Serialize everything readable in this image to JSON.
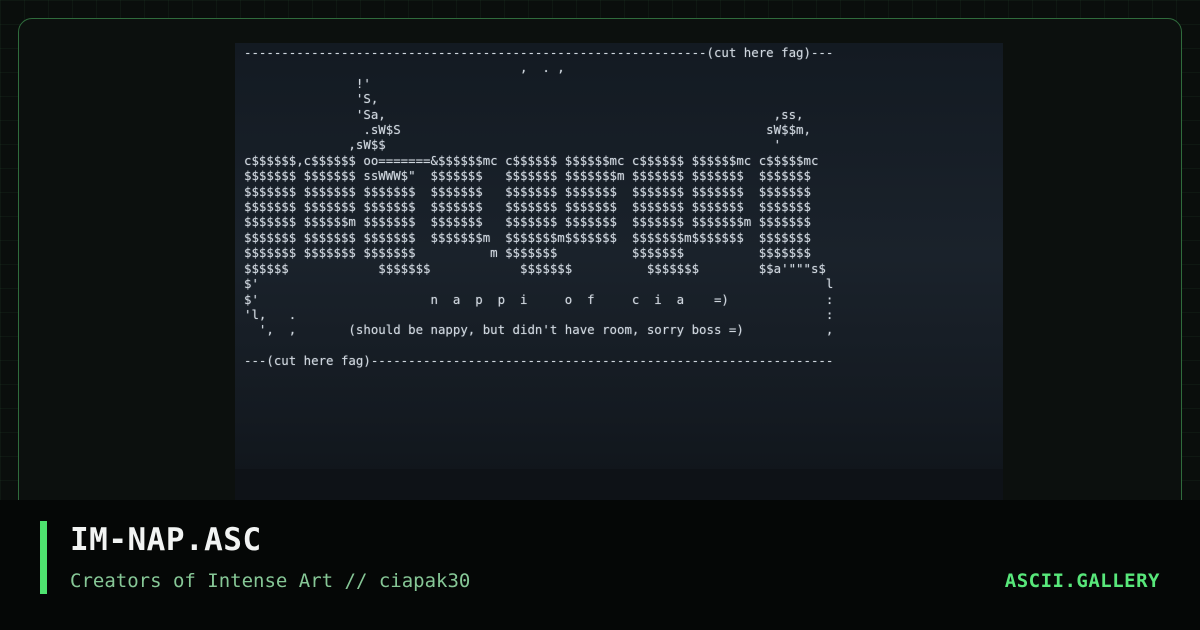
{
  "artwork": {
    "ascii_lines": [
      "--------------------------------------------------------------(cut here fag)---",
      "                                     ,  . ,",
      "               !'",
      "               'S,",
      "               'Sa,                                                    ,ss,",
      "                .sW$S                                                 sW$$m,",
      "              ,sW$$                                                    '",
      "c$$$$$$,c$$$$$$ oo=======&$$$$$$mc c$$$$$$ $$$$$$mc c$$$$$$ $$$$$$mc c$$$$$mc",
      "$$$$$$$ $$$$$$$ ssWWW$\"  $$$$$$$   $$$$$$$ $$$$$$$m $$$$$$$ $$$$$$$  $$$$$$$",
      "$$$$$$$ $$$$$$$ $$$$$$$  $$$$$$$   $$$$$$$ $$$$$$$  $$$$$$$ $$$$$$$  $$$$$$$",
      "$$$$$$$ $$$$$$$ $$$$$$$  $$$$$$$   $$$$$$$ $$$$$$$  $$$$$$$ $$$$$$$  $$$$$$$",
      "$$$$$$$ $$$$$$m $$$$$$$  $$$$$$$   $$$$$$$ $$$$$$$  $$$$$$$ $$$$$$$m $$$$$$$",
      "$$$$$$$ $$$$$$$ $$$$$$$  $$$$$$$m  $$$$$$$m$$$$$$$  $$$$$$$m$$$$$$$  $$$$$$$",
      "$$$$$$$ $$$$$$$ $$$$$$$          m $$$$$$$          $$$$$$$          $$$$$$$",
      "$$$$$$            $$$$$$$            $$$$$$$          $$$$$$$        $$a'\"\"\"s$",
      "$'                                                                            l",
      "$'                       n  a  p  p  i     o  f     c  i  a    =)             :",
      "'l,   .                                                                       :",
      "  ',  ,       (should be nappy, but didn't have room, sorry boss =)           ,",
      "",
      "---(cut here fag)--------------------------------------------------------------"
    ]
  },
  "footer": {
    "title": "IM-NAP.ASC",
    "subtitle": "Creators of Intense Art // ciapak30",
    "brand": "ASCII.GALLERY"
  },
  "colors": {
    "accent": "#4ee26f",
    "frame_border": "#2f6b3c",
    "subtitle": "#86c796",
    "brand": "#58e77a"
  }
}
